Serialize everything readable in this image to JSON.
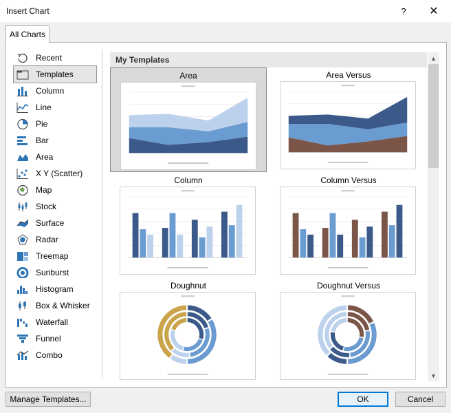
{
  "window": {
    "title": "Insert Chart",
    "help_label": "?",
    "close_label": "✕"
  },
  "tabs": [
    {
      "label": "All Charts"
    }
  ],
  "sidebar": {
    "items": [
      {
        "label": "Recent",
        "icon": "recent-icon"
      },
      {
        "label": "Templates",
        "icon": "templates-icon",
        "selected": true
      },
      {
        "label": "Column",
        "icon": "column-icon"
      },
      {
        "label": "Line",
        "icon": "line-icon"
      },
      {
        "label": "Pie",
        "icon": "pie-icon"
      },
      {
        "label": "Bar",
        "icon": "bar-icon"
      },
      {
        "label": "Area",
        "icon": "area-icon"
      },
      {
        "label": "X Y (Scatter)",
        "icon": "scatter-icon"
      },
      {
        "label": "Map",
        "icon": "map-icon"
      },
      {
        "label": "Stock",
        "icon": "stock-icon"
      },
      {
        "label": "Surface",
        "icon": "surface-icon"
      },
      {
        "label": "Radar",
        "icon": "radar-icon"
      },
      {
        "label": "Treemap",
        "icon": "treemap-icon"
      },
      {
        "label": "Sunburst",
        "icon": "sunburst-icon"
      },
      {
        "label": "Histogram",
        "icon": "histogram-icon"
      },
      {
        "label": "Box & Whisker",
        "icon": "box-whisker-icon"
      },
      {
        "label": "Waterfall",
        "icon": "waterfall-icon"
      },
      {
        "label": "Funnel",
        "icon": "funnel-icon"
      },
      {
        "label": "Combo",
        "icon": "combo-icon"
      }
    ]
  },
  "gallery": {
    "section_title": "My Templates",
    "templates": [
      {
        "name": "Area",
        "kind": "area",
        "selected": true
      },
      {
        "name": "Area Versus",
        "kind": "area-versus"
      },
      {
        "name": "Column",
        "kind": "column"
      },
      {
        "name": "Column Versus",
        "kind": "column-versus"
      },
      {
        "name": "Doughnut",
        "kind": "doughnut"
      },
      {
        "name": "Doughnut Versus",
        "kind": "doughnut-versus"
      }
    ]
  },
  "colors": {
    "accent": "#0078d7",
    "dark_blue": "#3b5a8a",
    "mid_blue": "#6a9bd1",
    "light_blue": "#bcd1ec",
    "brown": "#7b5548",
    "gold": "#c9a44a",
    "icon_blue": "#2e75b6"
  },
  "footer": {
    "manage_label": "Manage Templates...",
    "ok_label": "OK",
    "cancel_label": "Cancel"
  }
}
